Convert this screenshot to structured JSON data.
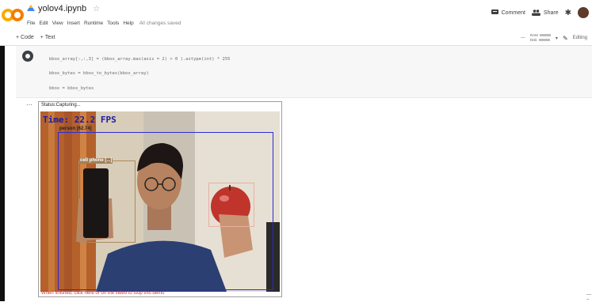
{
  "notebook": {
    "file_name": "yolov4.ipynb",
    "menus": [
      "File",
      "Edit",
      "View",
      "Insert",
      "Runtime",
      "Tools",
      "Help"
    ],
    "save_status": "All changes saved"
  },
  "header_right": {
    "comment_label": "Comment",
    "share_label": "Share"
  },
  "toolbar": {
    "add_code_label": "+ Code",
    "add_text_label": "+ Text",
    "ram_label": "RAM",
    "disk_label": "Disk",
    "editing_label": "Editing"
  },
  "cell": {
    "code_lines": [
      "bbox_array[:,:,3] = (bbox_array.max(axis = 2) > 0 ).astype(int) * 255",
      "bbox_bytes = bbox_to_bytes(bbox_array)",
      "bbox = bbox_bytes"
    ]
  },
  "output": {
    "status_text": "Status:Capturing...",
    "fps_text": "Time: 22.2 FPS",
    "detections": [
      {
        "label": "person [62.74]",
        "color": "#2b2bd6"
      },
      {
        "label": "cell phone [...]",
        "color": "#b08a60"
      },
      {
        "label": "apple",
        "color": "#e8b0a0"
      }
    ],
    "caption": "When finished, click here or on the video to stop this demo"
  },
  "colors": {
    "accent_blue": "#1a73e8",
    "caption_red": "#d32f2f"
  }
}
